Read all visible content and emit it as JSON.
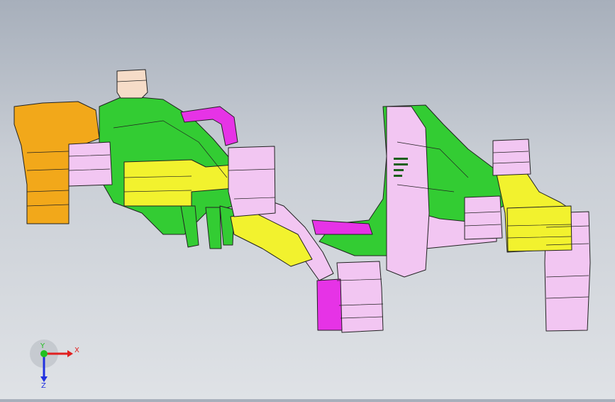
{
  "viewport": {
    "background_top": "#a7afbb",
    "background_bottom": "#dfe2e6"
  },
  "model": {
    "colors": {
      "green": "#33cc33",
      "green_dark": "#1a8f1a",
      "yellow": "#f2f22e",
      "orange": "#f2a81a",
      "magenta": "#e633e6",
      "pink": "#f2c6f2",
      "peach": "#f6dcc8",
      "edge": "#222222"
    }
  },
  "triad": {
    "x_label": "X",
    "y_label": "Y",
    "z_label": "Z",
    "x_color": "#e02020",
    "y_color": "#20c020",
    "z_color": "#2030e0"
  }
}
